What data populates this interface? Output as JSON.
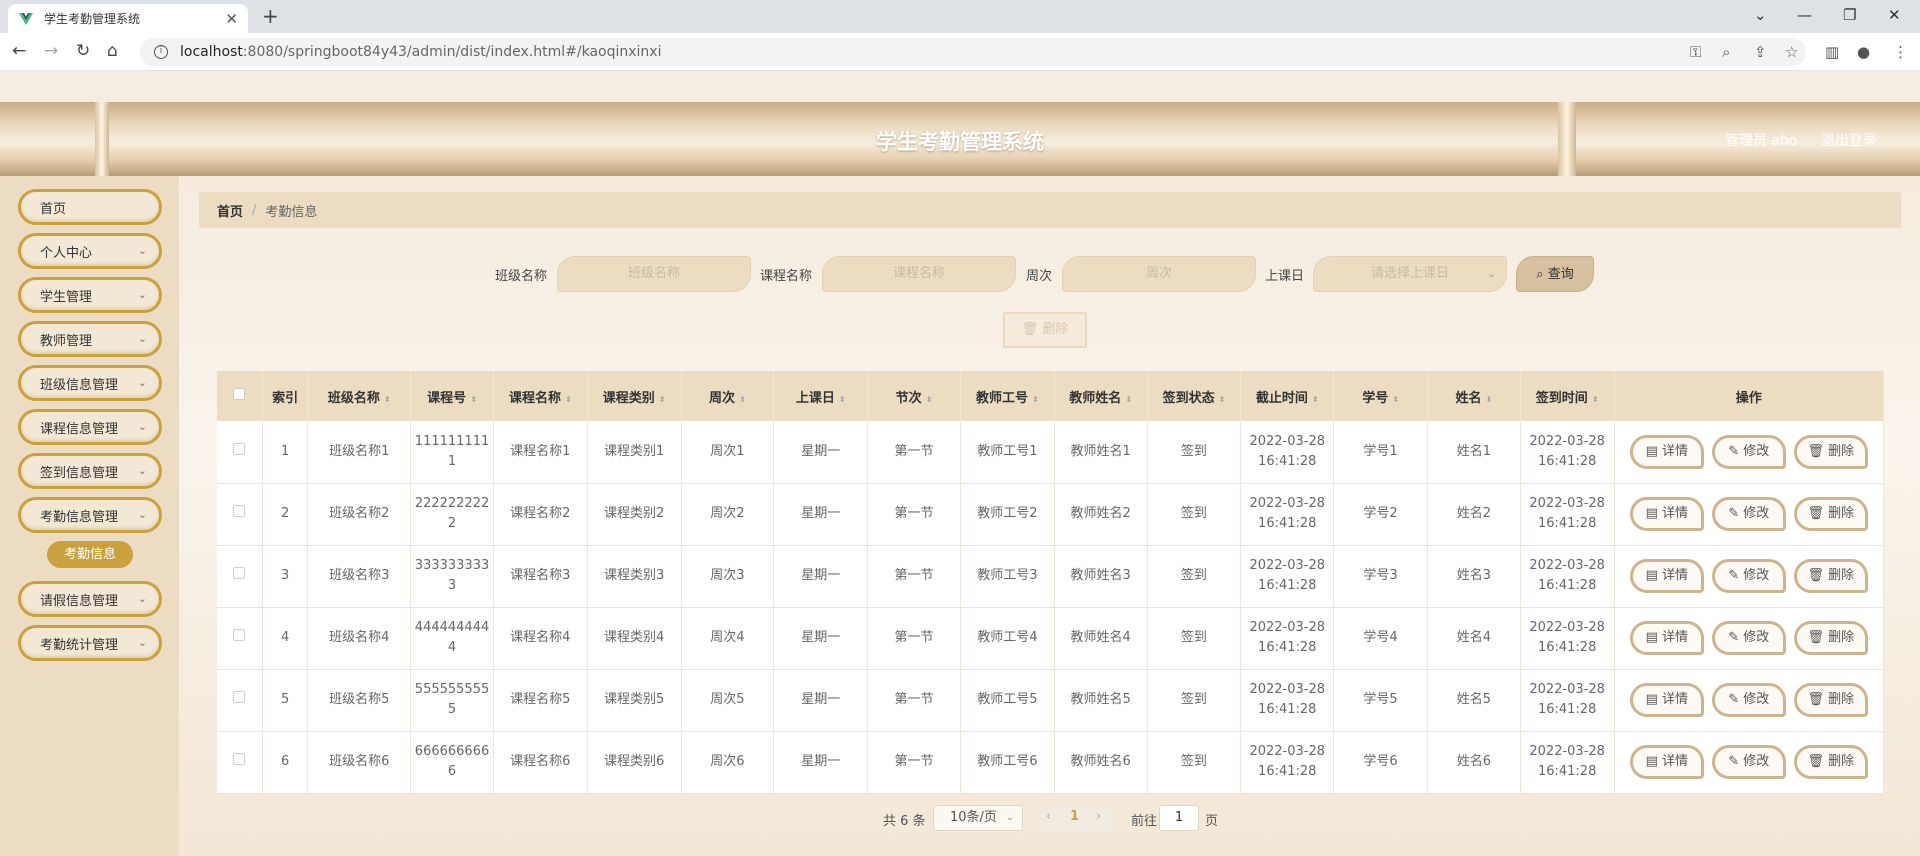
{
  "browser": {
    "tab_title": "学生考勤管理系统",
    "new_tab": "+",
    "url_host": "localhost",
    "url_path": ":8080/springboot84y43/admin/dist/index.html#/kaoqinxinxi"
  },
  "header": {
    "title": "学生考勤管理系统",
    "user": "管理员 abo",
    "logout": "退出登录"
  },
  "sidebar": {
    "items": [
      {
        "label": "首页"
      },
      {
        "label": "个人中心"
      },
      {
        "label": "学生管理"
      },
      {
        "label": "教师管理"
      },
      {
        "label": "班级信息管理"
      },
      {
        "label": "课程信息管理"
      },
      {
        "label": "签到信息管理"
      },
      {
        "label": "考勤信息管理"
      },
      {
        "label": "请假信息管理"
      },
      {
        "label": "考勤统计管理"
      }
    ],
    "active_sub": "考勤信息"
  },
  "breadcrumb": {
    "home": "首页",
    "separator": "/",
    "current": "考勤信息"
  },
  "search": {
    "class_label": "班级名称",
    "class_placeholder": "班级名称",
    "course_label": "课程名称",
    "course_placeholder": "课程名称",
    "week_label": "周次",
    "week_placeholder": "周次",
    "day_label": "上课日",
    "day_placeholder": "请选择上课日",
    "query_button": "查询"
  },
  "delete_button": "删除",
  "table": {
    "columns": [
      "索引",
      "班级名称",
      "课程号",
      "课程名称",
      "课程类别",
      "周次",
      "上课日",
      "节次",
      "教师工号",
      "教师姓名",
      "签到状态",
      "截止时间",
      "学号",
      "姓名",
      "签到时间",
      "操作"
    ],
    "rows": [
      {
        "idx": "1",
        "class": "班级名称1",
        "cno_a": "111111111",
        "cno_b": "1",
        "course": "课程名称1",
        "ctype": "课程类别1",
        "week": "周次1",
        "day": "星期一",
        "section": "第一节",
        "tno": "教师工号1",
        "tname": "教师姓名1",
        "status": "签到",
        "deadline_d": "2022-03-28",
        "deadline_t": "16:41:28",
        "sno": "学号1",
        "sname": "姓名1",
        "signin_d": "2022-03-28",
        "signin_t": "16:41:28"
      },
      {
        "idx": "2",
        "class": "班级名称2",
        "cno_a": "222222222",
        "cno_b": "2",
        "course": "课程名称2",
        "ctype": "课程类别2",
        "week": "周次2",
        "day": "星期一",
        "section": "第一节",
        "tno": "教师工号2",
        "tname": "教师姓名2",
        "status": "签到",
        "deadline_d": "2022-03-28",
        "deadline_t": "16:41:28",
        "sno": "学号2",
        "sname": "姓名2",
        "signin_d": "2022-03-28",
        "signin_t": "16:41:28"
      },
      {
        "idx": "3",
        "class": "班级名称3",
        "cno_a": "333333333",
        "cno_b": "3",
        "course": "课程名称3",
        "ctype": "课程类别3",
        "week": "周次3",
        "day": "星期一",
        "section": "第一节",
        "tno": "教师工号3",
        "tname": "教师姓名3",
        "status": "签到",
        "deadline_d": "2022-03-28",
        "deadline_t": "16:41:28",
        "sno": "学号3",
        "sname": "姓名3",
        "signin_d": "2022-03-28",
        "signin_t": "16:41:28"
      },
      {
        "idx": "4",
        "class": "班级名称4",
        "cno_a": "444444444",
        "cno_b": "4",
        "course": "课程名称4",
        "ctype": "课程类别4",
        "week": "周次4",
        "day": "星期一",
        "section": "第一节",
        "tno": "教师工号4",
        "tname": "教师姓名4",
        "status": "签到",
        "deadline_d": "2022-03-28",
        "deadline_t": "16:41:28",
        "sno": "学号4",
        "sname": "姓名4",
        "signin_d": "2022-03-28",
        "signin_t": "16:41:28"
      },
      {
        "idx": "5",
        "class": "班级名称5",
        "cno_a": "555555555",
        "cno_b": "5",
        "course": "课程名称5",
        "ctype": "课程类别5",
        "week": "周次5",
        "day": "星期一",
        "section": "第一节",
        "tno": "教师工号5",
        "tname": "教师姓名5",
        "status": "签到",
        "deadline_d": "2022-03-28",
        "deadline_t": "16:41:28",
        "sno": "学号5",
        "sname": "姓名5",
        "signin_d": "2022-03-28",
        "signin_t": "16:41:28"
      },
      {
        "idx": "6",
        "class": "班级名称6",
        "cno_a": "666666666",
        "cno_b": "6",
        "course": "课程名称6",
        "ctype": "课程类别6",
        "week": "周次6",
        "day": "星期一",
        "section": "第一节",
        "tno": "教师工号6",
        "tname": "教师姓名6",
        "status": "签到",
        "deadline_d": "2022-03-28",
        "deadline_t": "16:41:28",
        "sno": "学号6",
        "sname": "姓名6",
        "signin_d": "2022-03-28",
        "signin_t": "16:41:28"
      }
    ],
    "actions": {
      "detail": "详情",
      "edit": "修改",
      "delete": "删除"
    }
  },
  "pagination": {
    "total": "共 6 条",
    "page_size": "10条/页",
    "current_page": "1",
    "goto_label": "前往",
    "goto_value": "1",
    "page_suffix": "页"
  },
  "colors": {
    "accent": "#c9a23e",
    "header_bg": "#ecdcc2"
  }
}
